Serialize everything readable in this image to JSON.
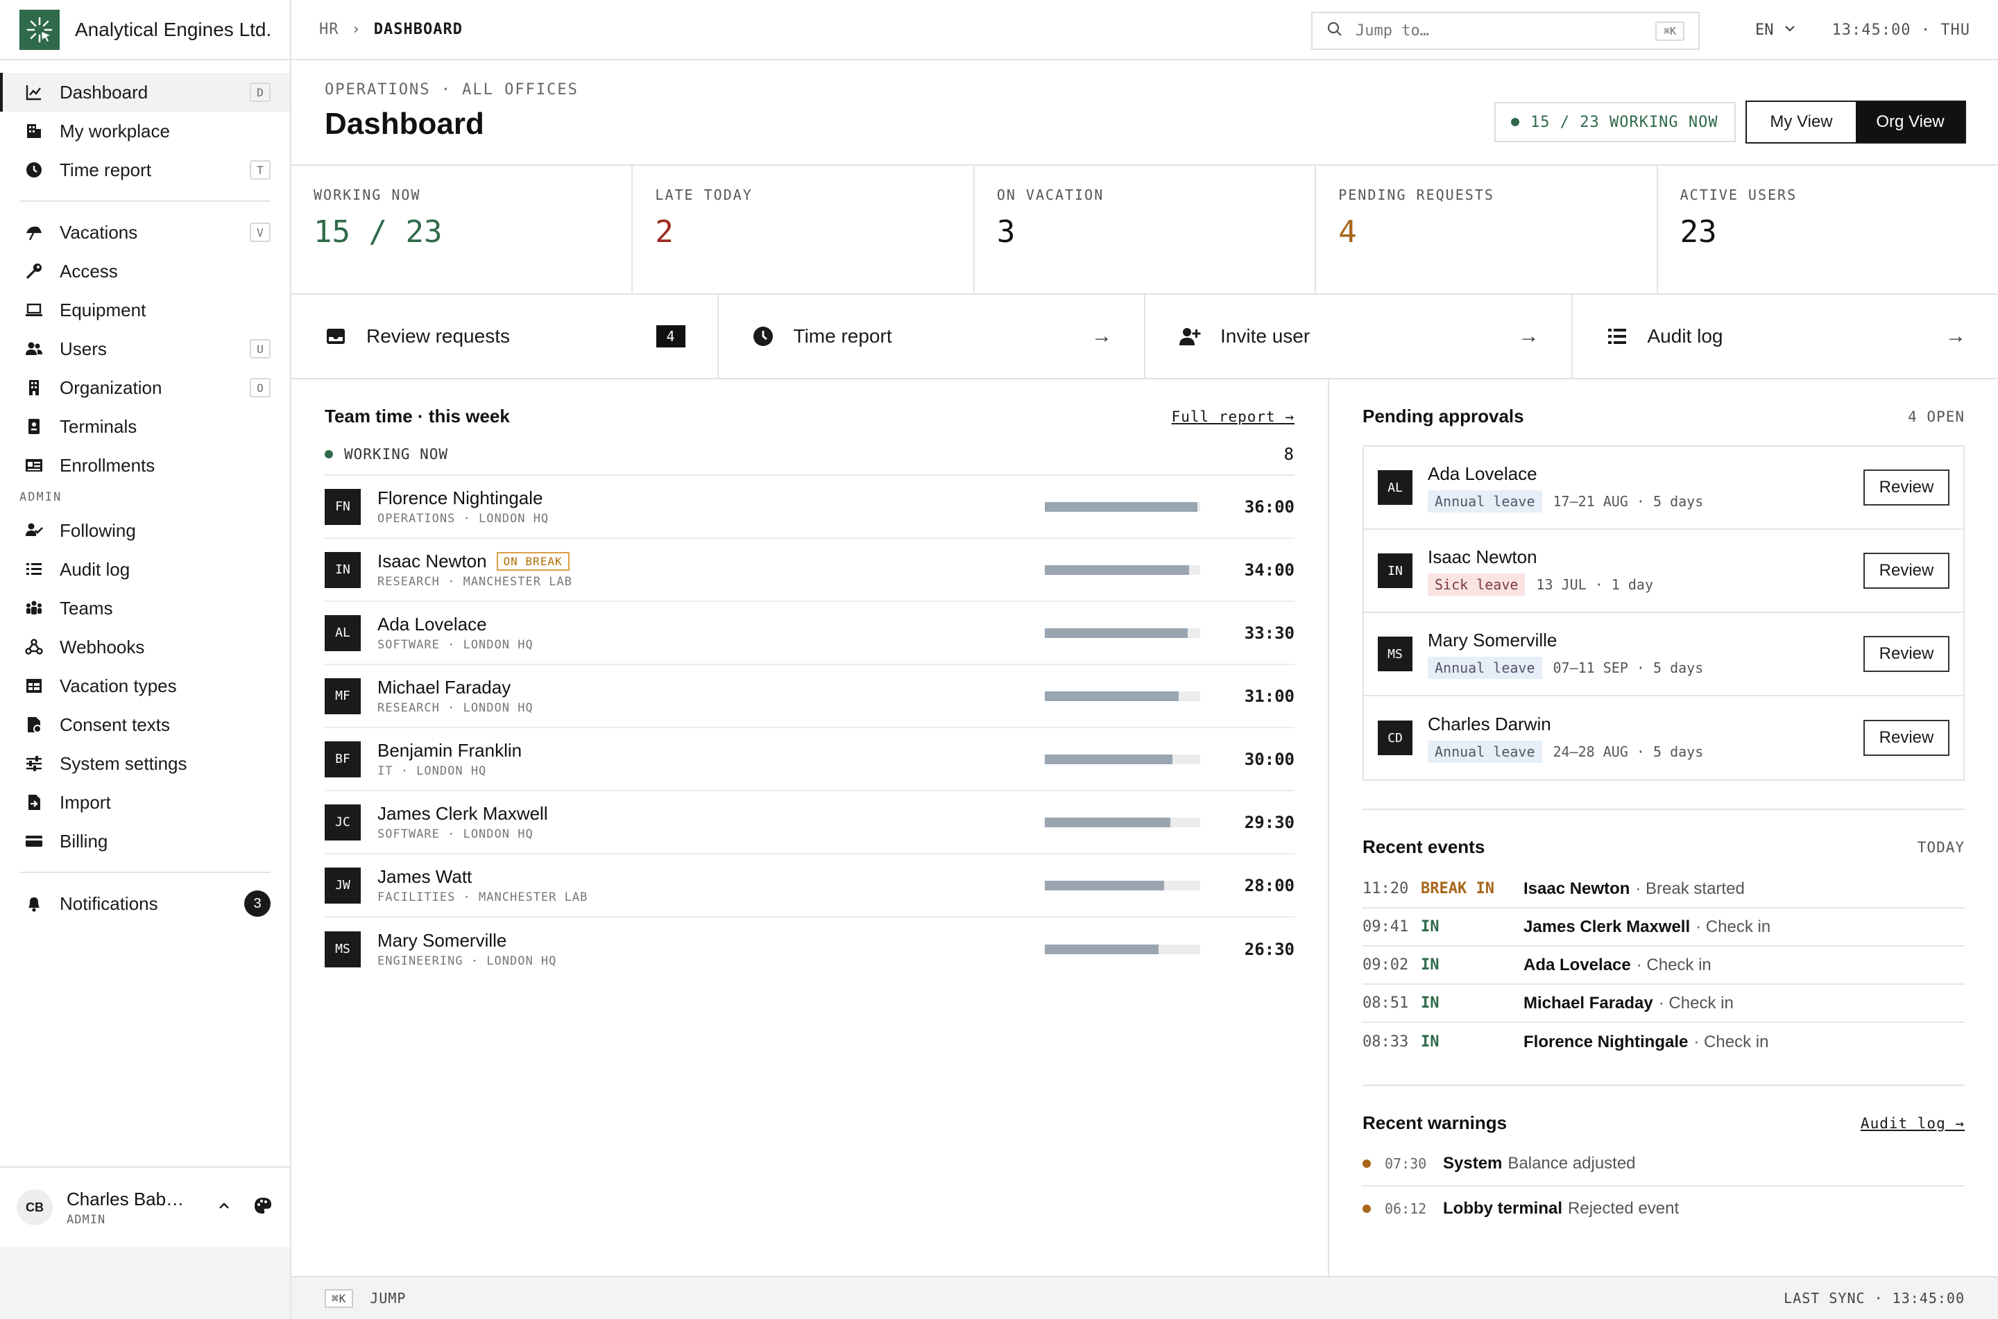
{
  "app": {
    "name": "Analytical Engines Ltd."
  },
  "sidebar": {
    "primary": [
      {
        "label": "Dashboard",
        "key": "D",
        "icon": "chart-icon"
      },
      {
        "label": "My workplace",
        "key": "",
        "icon": "building-icon"
      },
      {
        "label": "Time report",
        "key": "T",
        "icon": "clock-icon"
      }
    ],
    "secondary": [
      {
        "label": "Vacations",
        "key": "V",
        "icon": "umbrella-icon"
      },
      {
        "label": "Access",
        "key": "",
        "icon": "key-icon"
      },
      {
        "label": "Equipment",
        "key": "",
        "icon": "laptop-icon"
      },
      {
        "label": "Users",
        "key": "U",
        "icon": "users-icon"
      },
      {
        "label": "Organization",
        "key": "O",
        "icon": "org-icon"
      },
      {
        "label": "Terminals",
        "key": "",
        "icon": "terminal-icon"
      },
      {
        "label": "Enrollments",
        "key": "",
        "icon": "id-card-icon"
      }
    ],
    "admin_title": "ADMIN",
    "admin": [
      {
        "label": "Following",
        "icon": "user-check-icon"
      },
      {
        "label": "Audit log",
        "icon": "list-icon"
      },
      {
        "label": "Teams",
        "icon": "team-icon"
      },
      {
        "label": "Webhooks",
        "icon": "webhook-icon"
      },
      {
        "label": "Vacation types",
        "icon": "table-icon"
      },
      {
        "label": "Consent texts",
        "icon": "doc-icon"
      },
      {
        "label": "System settings",
        "icon": "sliders-icon"
      },
      {
        "label": "Import",
        "icon": "import-icon"
      },
      {
        "label": "Billing",
        "icon": "card-icon"
      }
    ],
    "notifications": {
      "label": "Notifications",
      "count": "3"
    },
    "user": {
      "initials": "CB",
      "name": "Charles Bab…",
      "role": "ADMIN"
    }
  },
  "topbar": {
    "crumb_parent": "HR",
    "crumb_sep": "›",
    "crumb_current": "DASHBOARD",
    "search_placeholder": "Jump to…",
    "search_kbd": "⌘K",
    "lang": "EN",
    "clock": "13:45:00 · THU"
  },
  "header": {
    "eyebrow": "OPERATIONS · ALL OFFICES",
    "title": "Dashboard",
    "working_pill": "15 / 23 WORKING NOW",
    "views": [
      "My View",
      "Org View"
    ],
    "active_view": "Org View"
  },
  "stats": [
    {
      "label": "WORKING NOW",
      "value": "15 / 23",
      "color": "#2f6a4a"
    },
    {
      "label": "LATE TODAY",
      "value": "2",
      "color": "#9b2a1f"
    },
    {
      "label": "ON VACATION",
      "value": "3",
      "color": "#111111"
    },
    {
      "label": "PENDING REQUESTS",
      "value": "4",
      "color": "#a8661a"
    },
    {
      "label": "ACTIVE USERS",
      "value": "23",
      "color": "#111111"
    }
  ],
  "actions": [
    {
      "label": "Review requests",
      "count": "4",
      "icon": "inbox-icon"
    },
    {
      "label": "Time report",
      "icon": "clock-icon"
    },
    {
      "label": "Invite user",
      "icon": "user-plus-icon"
    },
    {
      "label": "Audit log",
      "icon": "list-icon"
    }
  ],
  "team": {
    "title": "Team time · this week",
    "link": "Full report →",
    "working_label": "WORKING NOW",
    "working_count": "8",
    "people": [
      {
        "initials": "FN",
        "name": "Florence Nightingale",
        "sub": "OPERATIONS · LONDON HQ",
        "hours": "36:00",
        "fill": 0.98,
        "badge": ""
      },
      {
        "initials": "IN",
        "name": "Isaac Newton",
        "sub": "RESEARCH · MANCHESTER LAB",
        "hours": "34:00",
        "fill": 0.93,
        "badge": "ON BREAK"
      },
      {
        "initials": "AL",
        "name": "Ada Lovelace",
        "sub": "SOFTWARE · LONDON HQ",
        "hours": "33:30",
        "fill": 0.92,
        "badge": ""
      },
      {
        "initials": "MF",
        "name": "Michael Faraday",
        "sub": "RESEARCH · LONDON HQ",
        "hours": "31:00",
        "fill": 0.86,
        "badge": ""
      },
      {
        "initials": "BF",
        "name": "Benjamin Franklin",
        "sub": "IT · LONDON HQ",
        "hours": "30:00",
        "fill": 0.82,
        "badge": ""
      },
      {
        "initials": "JC",
        "name": "James Clerk Maxwell",
        "sub": "SOFTWARE · LONDON HQ",
        "hours": "29:30",
        "fill": 0.81,
        "badge": ""
      },
      {
        "initials": "JW",
        "name": "James Watt",
        "sub": "FACILITIES · MANCHESTER LAB",
        "hours": "28:00",
        "fill": 0.77,
        "badge": ""
      },
      {
        "initials": "MS",
        "name": "Mary Somerville",
        "sub": "ENGINEERING · LONDON HQ",
        "hours": "26:30",
        "fill": 0.73,
        "badge": ""
      }
    ]
  },
  "approvals": {
    "title": "Pending approvals",
    "count": "4 OPEN",
    "button": "Review",
    "items": [
      {
        "initials": "AL",
        "name": "Ada Lovelace",
        "type": "Annual leave",
        "kind": "annual",
        "when": "17–21 AUG · 5 days"
      },
      {
        "initials": "IN",
        "name": "Isaac Newton",
        "type": "Sick leave",
        "kind": "sick",
        "when": "13 JUL · 1 day"
      },
      {
        "initials": "MS",
        "name": "Mary Somerville",
        "type": "Annual leave",
        "kind": "annual",
        "when": "07–11 SEP · 5 days"
      },
      {
        "initials": "CD",
        "name": "Charles Darwin",
        "type": "Annual leave",
        "kind": "annual",
        "when": "24–28 AUG · 5 days"
      }
    ]
  },
  "events": {
    "title": "Recent events",
    "range": "TODAY",
    "items": [
      {
        "time": "11:20",
        "type": "BREAK IN",
        "color": "#a8661a",
        "who": "Isaac Newton",
        "what": "· Break started"
      },
      {
        "time": "09:41",
        "type": "IN",
        "color": "#2f6a4a",
        "who": "James Clerk Maxwell",
        "what": "· Check in"
      },
      {
        "time": "09:02",
        "type": "IN",
        "color": "#2f6a4a",
        "who": "Ada Lovelace",
        "what": "· Check in"
      },
      {
        "time": "08:51",
        "type": "IN",
        "color": "#2f6a4a",
        "who": "Michael Faraday",
        "what": "· Check in"
      },
      {
        "time": "08:33",
        "type": "IN",
        "color": "#2f6a4a",
        "who": "Florence Nightingale",
        "what": "· Check in"
      }
    ]
  },
  "warnings": {
    "title": "Recent warnings",
    "link": "Audit log →",
    "items": [
      {
        "time": "07:30",
        "who": "System",
        "what": "Balance adjusted"
      },
      {
        "time": "06:12",
        "who": "Lobby terminal",
        "what": "Rejected event"
      }
    ]
  },
  "footer": {
    "kbd": "⌘K",
    "jump": "JUMP",
    "sync": "LAST SYNC · 13:45:00"
  }
}
